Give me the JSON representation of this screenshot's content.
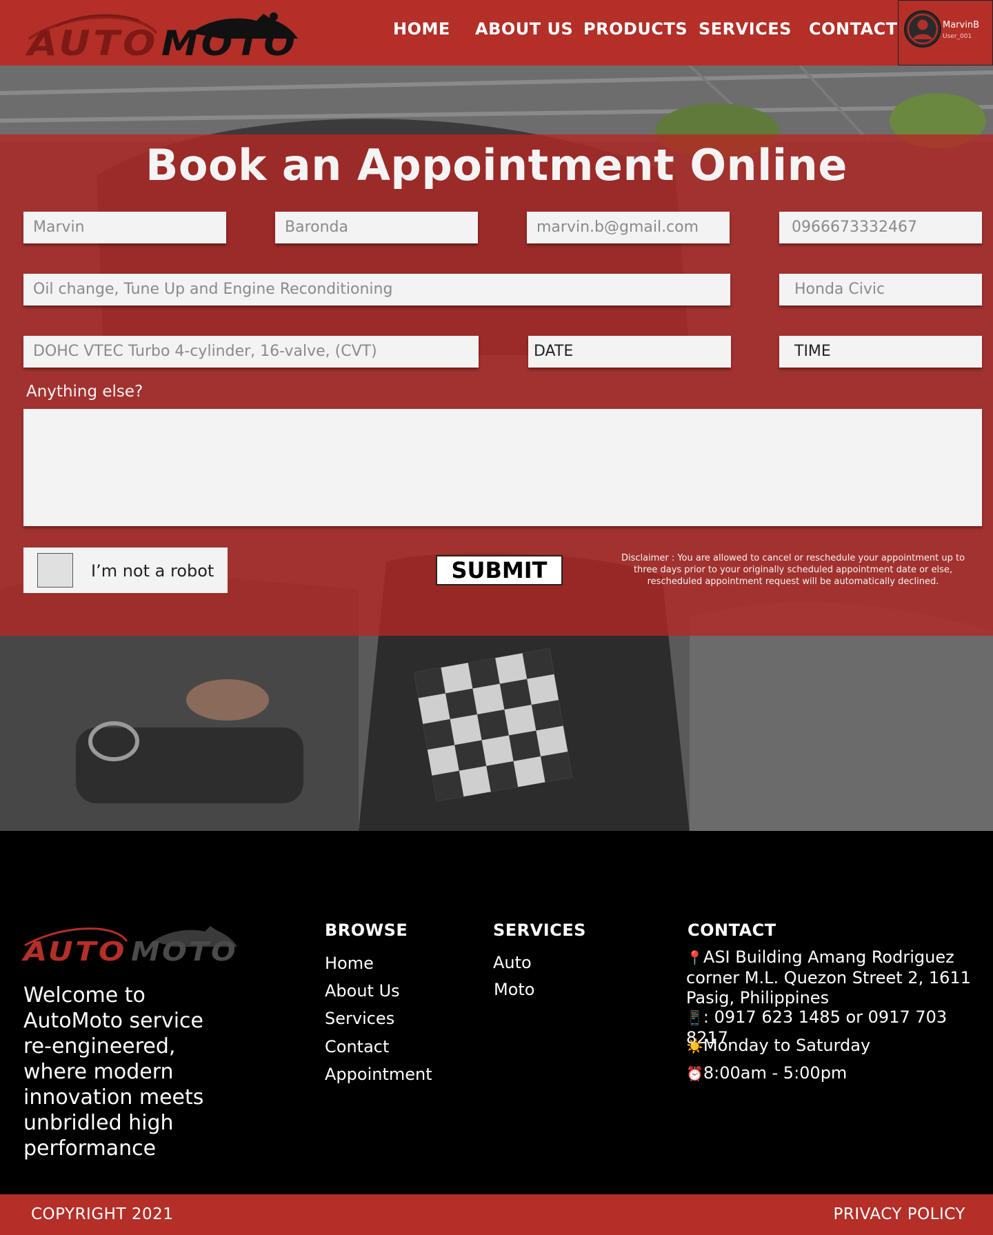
{
  "brand": {
    "name_auto": "AUTO",
    "name_moto": "MOTO"
  },
  "nav": {
    "items": [
      {
        "label": "HOME"
      },
      {
        "label": "ABOUT US"
      },
      {
        "label": "PRODUCTS"
      },
      {
        "label": "SERVICES"
      },
      {
        "label": "CONTACT"
      }
    ],
    "user": {
      "name": "MarvinB",
      "id": "User_001",
      "icon": "user-avatar-icon"
    }
  },
  "booking": {
    "title": "Book an Appointment Online",
    "fields": {
      "first_name": "Marvin",
      "last_name": "Baronda",
      "email": "marvin.b@gmail.com",
      "phone": "0966673332467",
      "service": "Oil change, Tune Up and Engine Reconditioning",
      "vehicle": "Honda Civic",
      "engine": "DOHC VTEC Turbo 4-cylinder, 16-valve, (CVT)",
      "date": "DATE",
      "time": "TIME"
    },
    "notes_label": "Anything else?",
    "notes_value": "",
    "captcha_label": "I’m not a robot",
    "submit_label": "SUBMIT",
    "disclaimer": "Disclaimer : You are allowed to cancel or reschedule your appointment up to three days prior to your originally scheduled appointment date or else, rescheduled appointment request will be automatically declined."
  },
  "footer": {
    "welcome": "Welcome to AutoMoto service re-engineered, where modern innovation meets unbridled high performance",
    "browse": {
      "heading": "BROWSE",
      "links": [
        "Home",
        "About Us",
        "Services",
        "Contact",
        "Appointment"
      ]
    },
    "services": {
      "heading": "SERVICES",
      "links": [
        "Auto",
        "Moto"
      ]
    },
    "contact": {
      "heading": "CONTACT",
      "address": "ASI Building Amang Rodriguez corner M.L. Quezon Street 2, 1611 Pasig, Philippines",
      "phone": ": 0917 623 1485 or 0917 703 8217",
      "days": "Monday to Saturday",
      "hours": "8:00am - 5:00pm",
      "icons": {
        "address": "📍",
        "phone": "📱",
        "days": "☀️",
        "hours": "⏰"
      }
    },
    "copyright": "COPYRIGHT 2021",
    "privacy": "PRIVACY POLICY"
  },
  "colors": {
    "brand_red": "#b32f28",
    "overlay_red": "rgba(180,40,36,0.80)",
    "field_bg": "#f3f3f3",
    "footer_bg": "#000000"
  }
}
